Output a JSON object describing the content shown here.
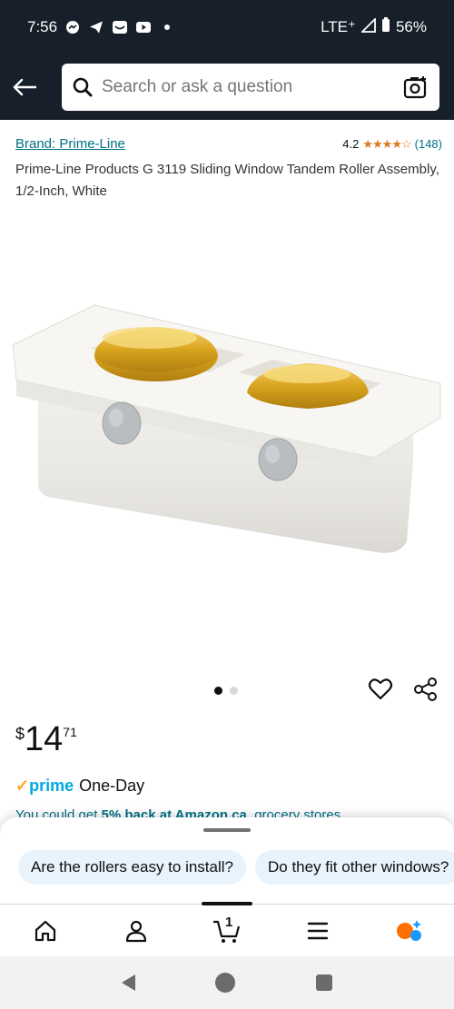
{
  "status_bar": {
    "time": "7:56",
    "network": "LTE⁺",
    "battery": "56%",
    "icons": [
      "messenger-icon",
      "telegram-icon",
      "inbox-icon",
      "youtube-icon",
      "dot-icon"
    ]
  },
  "search": {
    "placeholder": "Search or ask a question"
  },
  "product": {
    "brand": "Brand: Prime-Line",
    "rating": "4.2",
    "stars": "★★★★☆",
    "rating_count": "(148)",
    "title": "Prime-Line Products G 3119 Sliding Window Tandem Roller Assembly, 1/2-Inch, White",
    "image_alt": "white tandem roller assembly with two brass wheels"
  },
  "gallery": {
    "image_count": 2,
    "active_index": 0
  },
  "price": {
    "symbol": "$",
    "whole": "14",
    "fraction": "71"
  },
  "prime": {
    "check": "✓",
    "logo": "prime",
    "delivery": "One-Day"
  },
  "cashback": {
    "prefix": "You could get ",
    "bold": "5% back at Amazon.ca",
    "suffix": ", grocery stores"
  },
  "questions": [
    "Are the rollers easy to install?",
    "Do they fit other windows?"
  ],
  "nav": {
    "cart_count": "1"
  },
  "colors": {
    "header_bg": "#17202a",
    "link": "#007185",
    "star": "#de7921",
    "prime_blue": "#00a8e1",
    "chip_bg": "#e9f3fb"
  }
}
